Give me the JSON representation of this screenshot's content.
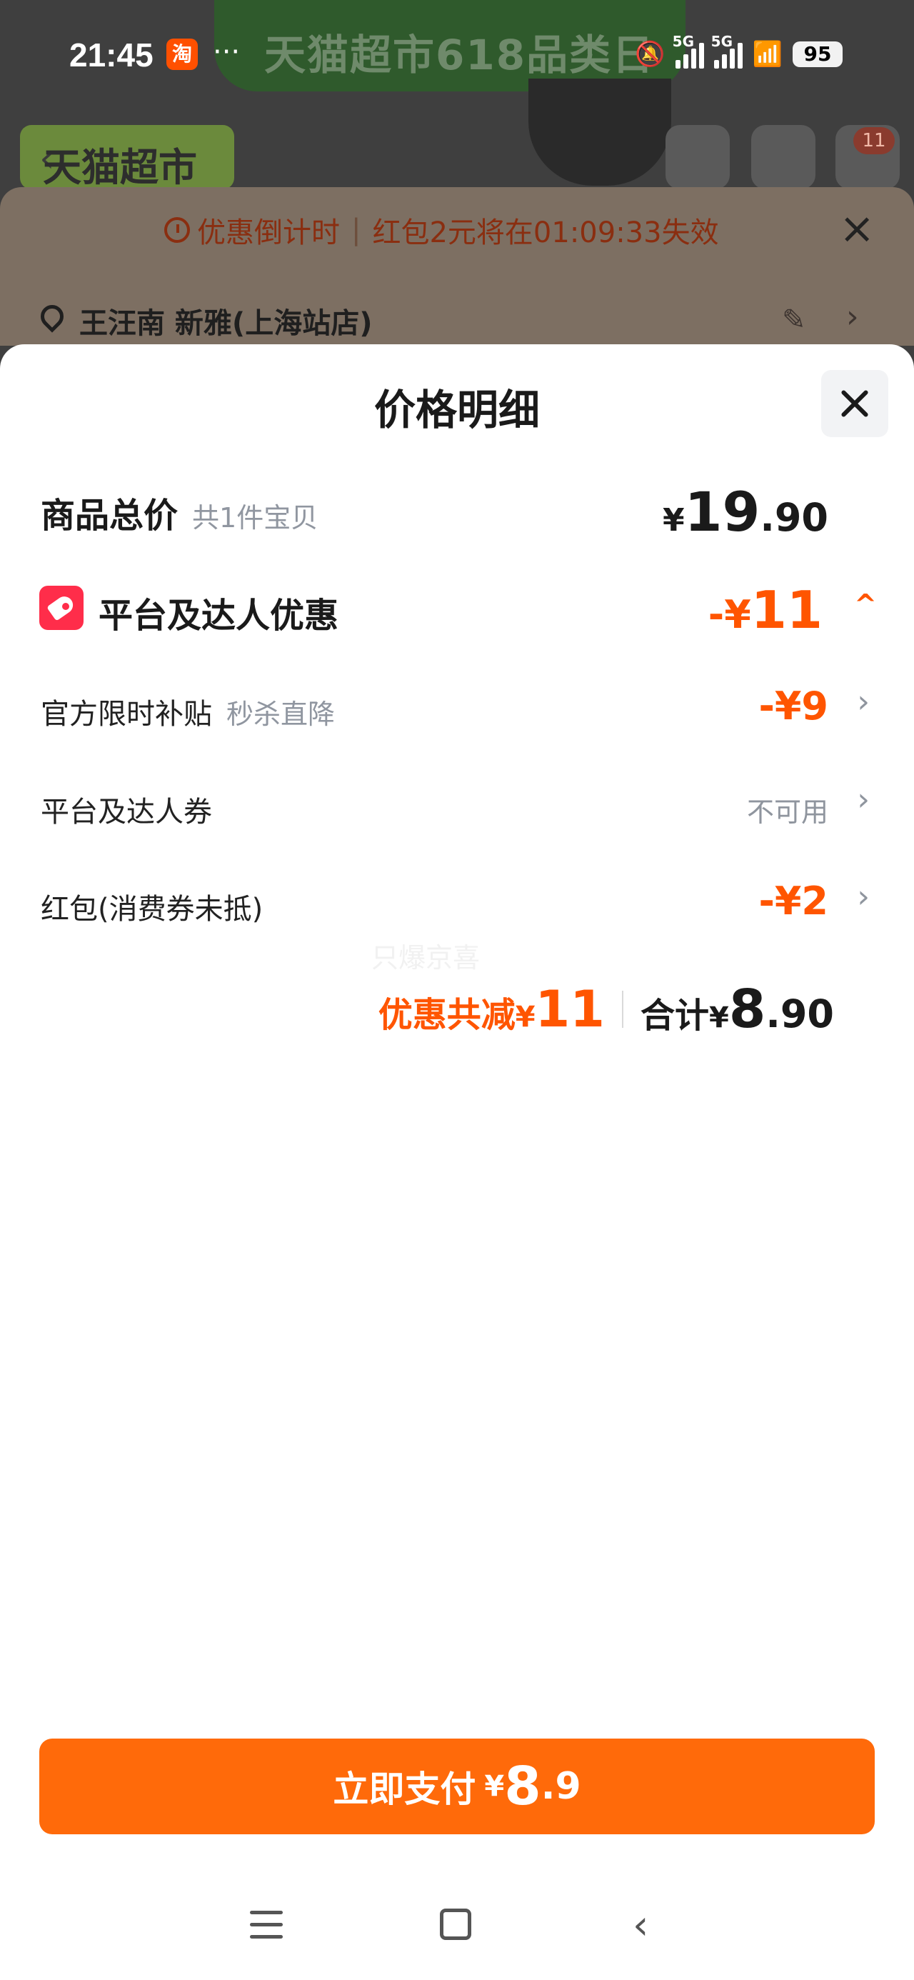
{
  "status_bar": {
    "time": "21:45",
    "app_badge": "淘",
    "more": "···",
    "signal1": "5G",
    "signal2": "5G",
    "battery": "95"
  },
  "background": {
    "banner_text": "天猫超市618品类日",
    "store_text": "天猫超市",
    "cart_badge": "11"
  },
  "countdown": {
    "label": "优惠倒计时",
    "separator": "|",
    "message": "红包2元将在01:09:33失效"
  },
  "address": {
    "text": "王汪南 新雅(上海站店)"
  },
  "sheet": {
    "title": "价格明细",
    "total_row": {
      "label": "商品总价",
      "sub": "共1件宝贝",
      "currency": "¥",
      "int": "19",
      "dec": ".90"
    },
    "discount_row": {
      "label": "平台及达人优惠",
      "prefix": "-",
      "currency": "¥",
      "int": "11"
    },
    "subsidy_row": {
      "label": "官方限时补贴",
      "sub": "秒杀直降",
      "value": "-¥9"
    },
    "coupon_row": {
      "label": "平台及达人券",
      "value": "不可用"
    },
    "redpacket_row": {
      "label": "红包(消费券未抵)",
      "value": "-¥2"
    },
    "watermark": "只爆京喜",
    "summary": {
      "discount_label": "优惠共减",
      "discount_currency": "¥",
      "discount_value": "11",
      "total_label": "合计",
      "total_currency": "¥",
      "total_int": "8",
      "total_dec": ".90"
    },
    "pay_button": {
      "label": "立即支付",
      "currency": "¥",
      "int": "8",
      "dec": ".9"
    }
  },
  "colors": {
    "accent": "#ff5500",
    "pay_button": "#ff6a0a",
    "tag_red": "#ff2d4a"
  },
  "icons": [
    "location-pin-icon",
    "clock-icon",
    "close-icon",
    "tag-icon",
    "chevron-right-icon",
    "chevron-up-icon",
    "edit-icon",
    "menu-icon",
    "home-icon",
    "back-icon"
  ]
}
